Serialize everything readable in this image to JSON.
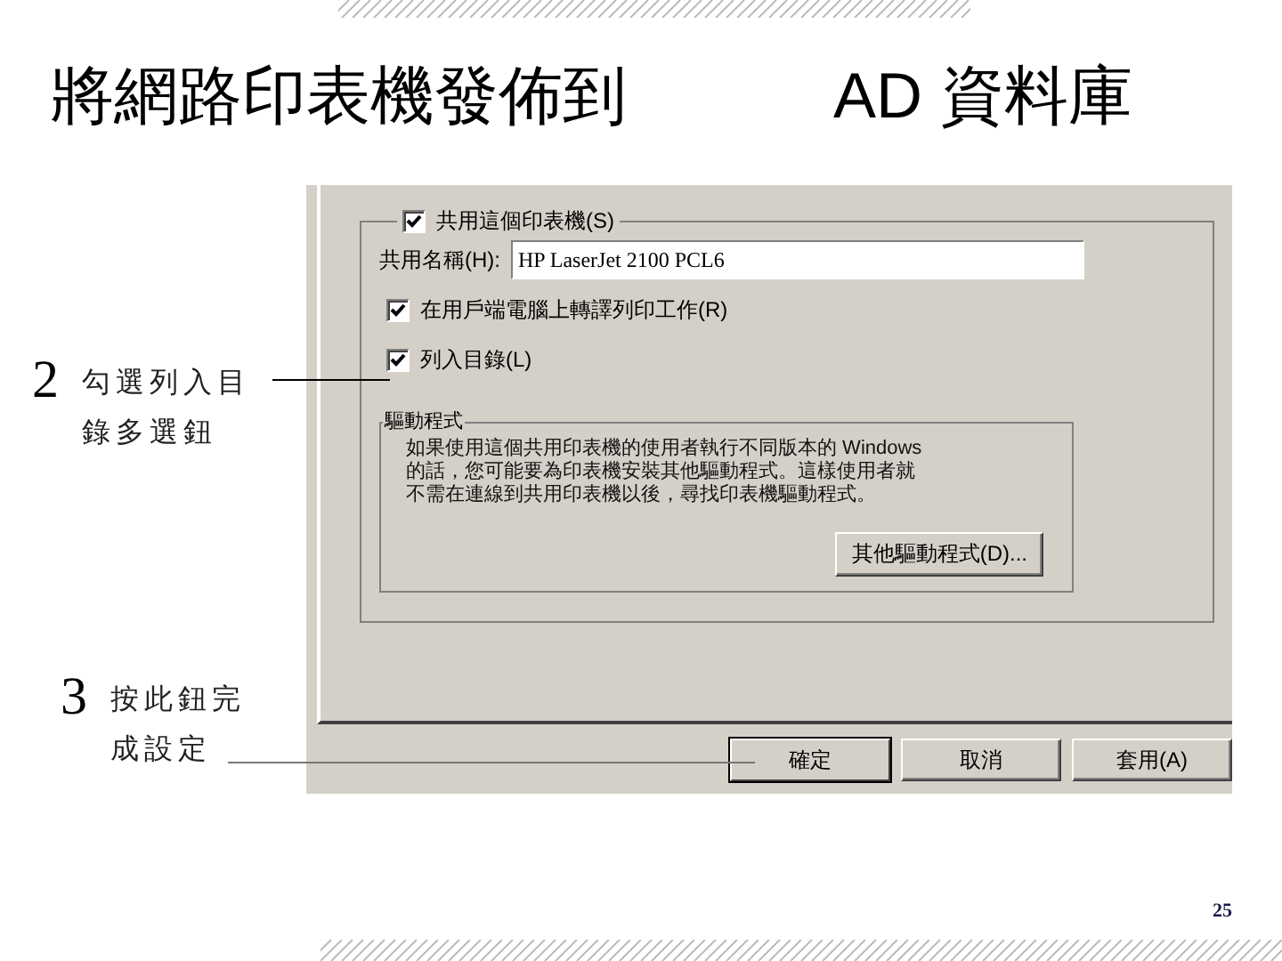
{
  "slide": {
    "title_left": "將網路印表機發佈到",
    "title_right": "AD 資料庫",
    "page_number": "25"
  },
  "callouts": [
    {
      "number": "2",
      "lines": [
        "勾選列入目",
        "錄多選鈕"
      ]
    },
    {
      "number": "3",
      "lines": [
        "按此鈕完",
        "成設定"
      ]
    }
  ],
  "dialog": {
    "share": {
      "label": "共用這個印表機(S)",
      "checked": true
    },
    "share_name": {
      "label": "共用名稱(H):",
      "value": "HP LaserJet 2100 PCL6"
    },
    "options": [
      {
        "label": "在用戶端電腦上轉譯列印工作(R)",
        "checked": true
      },
      {
        "label": "列入目錄(L)",
        "checked": true
      }
    ],
    "drivers": {
      "title": "驅動程式",
      "text_lines": [
        "如果使用這個共用印表機的使用者執行不同版本的 Windows",
        "的話，您可能要為印表機安裝其他驅動程式。這樣使用者就",
        "不需在連線到共用印表機以後，尋找印表機驅動程式。"
      ],
      "button": "其他驅動程式(D)..."
    },
    "buttons": [
      {
        "label": "確定",
        "default": true
      },
      {
        "label": "取消",
        "default": false
      },
      {
        "label": "套用(A)",
        "default": false
      }
    ]
  }
}
